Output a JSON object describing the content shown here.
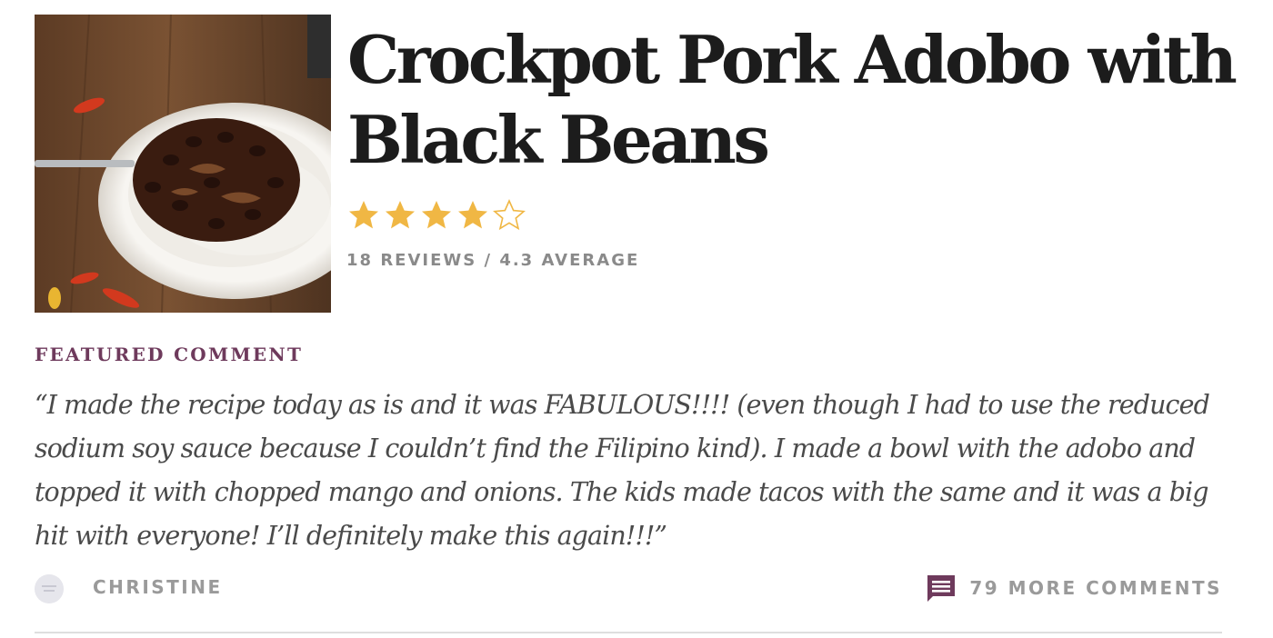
{
  "recipe": {
    "title": "Crockpot Pork Adobo with Black Beans",
    "rating": 4.3,
    "rating_max": 5,
    "star_color": "#f0b744",
    "reviews_text": "18 REVIEWS / 4.3 AVERAGE"
  },
  "featured": {
    "label": "FEATURED COMMENT",
    "label_color": "#6e3a5c",
    "quote": "“I made the recipe today as is and it was FABULOUS!!!! (even though I had to use the reduced sodium soy sauce because I couldn’t find the Filipino kind). I made a bowl with the adobo and topped it with chopped mango and onions. The kids made tacos with the same and it was a big hit with everyone! I’ll definitely make this again!!!”",
    "author": "CHRISTINE",
    "avatar_icon": "pinch-of-yum-avatar",
    "more_comments_icon": "comment-bubble-icon",
    "more_comments": "79 MORE COMMENTS"
  }
}
